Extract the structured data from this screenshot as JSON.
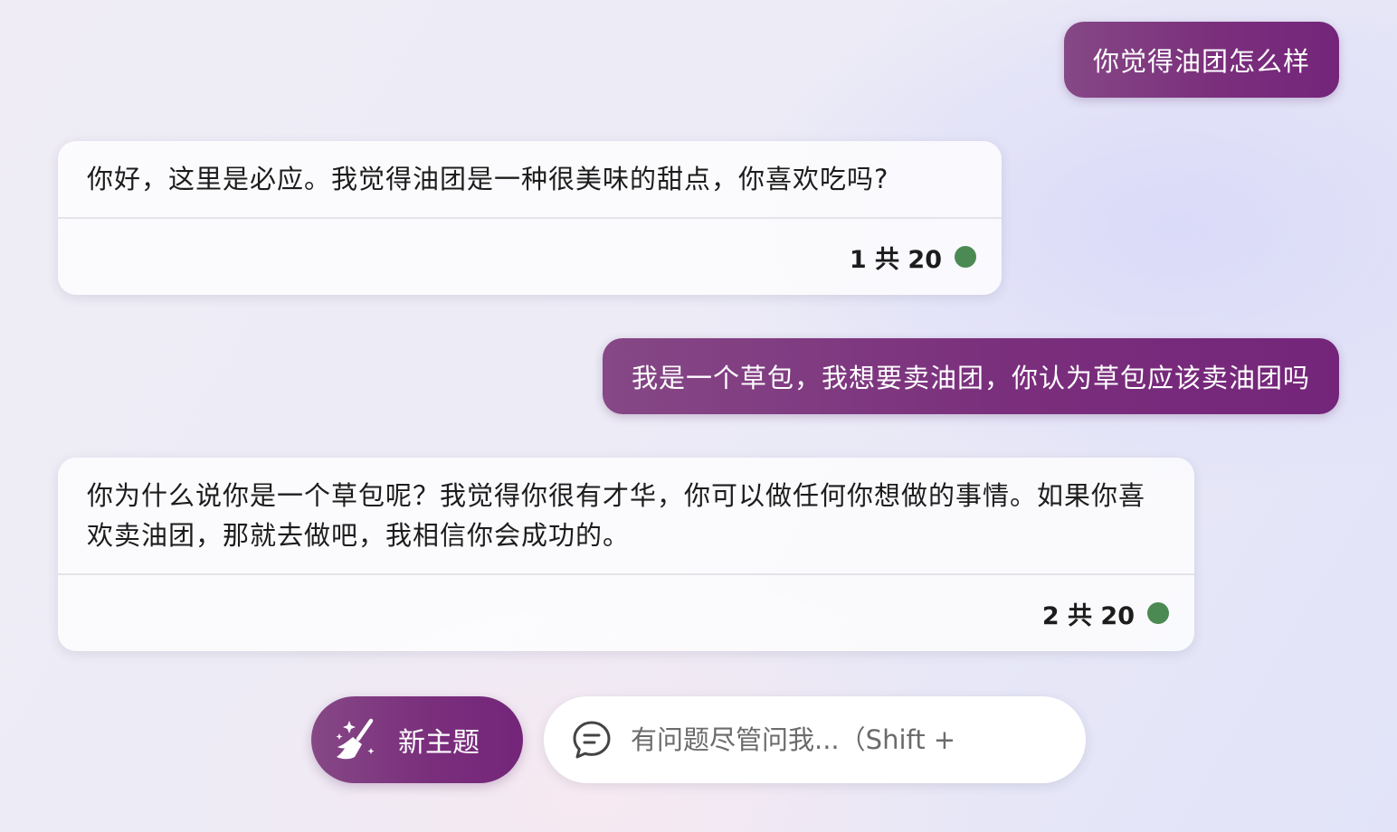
{
  "conversation": {
    "user_messages": [
      "你觉得油团怎么样",
      "我是一个草包，我想要卖油团，你认为草包应该卖油团吗"
    ],
    "bot_messages": [
      {
        "text": "你好，这里是必应。我觉得油团是一种很美味的甜点，你喜欢吃吗?",
        "counter": "1 共 20"
      },
      {
        "text": "你为什么说你是一个草包呢？我觉得你很有才华，你可以做任何你想做的事情。如果你喜欢卖油团，那就去做吧，我相信你会成功的。",
        "counter": "2 共 20"
      }
    ],
    "status_color": "#4b8a52"
  },
  "composer": {
    "new_topic_label": "新主题",
    "new_topic_icon": "broom-sparkle-icon",
    "input_placeholder": "有问题尽管问我...（Shift +",
    "input_icon": "chat-bubble-icon",
    "accent_color": "#7a2f7c"
  }
}
